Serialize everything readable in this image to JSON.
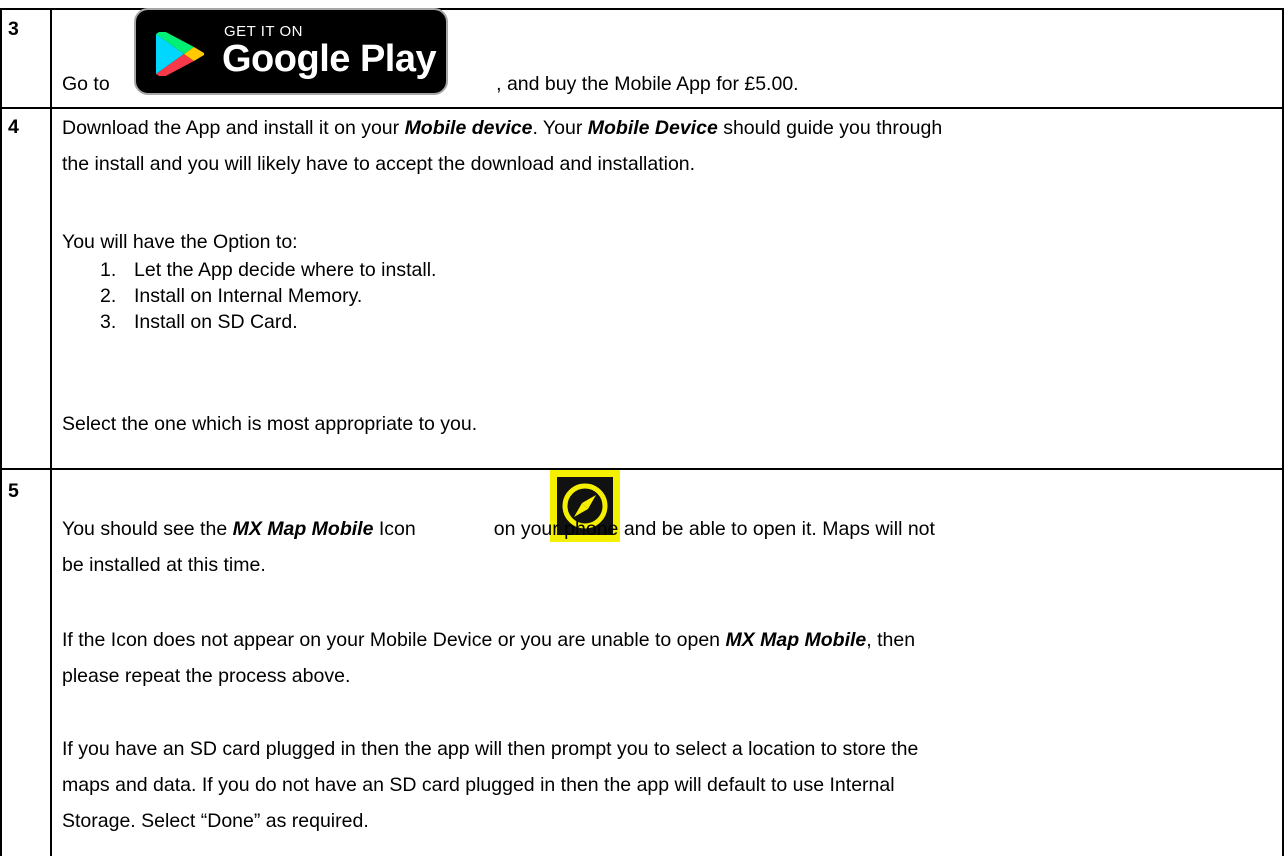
{
  "rows": [
    {
      "number": "3",
      "line1_prefix": "Go to",
      "line1_suffix": ", and buy the Mobile App for £5.00.",
      "badge": {
        "top_text": "GET IT ON",
        "name": "Google Play",
        "icon": "google-play-icon"
      }
    },
    {
      "number": "4",
      "p1_a": "Download the App and install it on your ",
      "p1_b": "Mobile device",
      "p1_c": ".  Your ",
      "p1_d": "Mobile Device",
      "p1_e": " should guide you through",
      "p1_line2": "the install and you will likely have to accept the download and installation.",
      "p2": "You will have the Option to:",
      "options": [
        {
          "n": "1.",
          "text": "Let the App decide where to install."
        },
        {
          "n": "2.",
          "text": "Install on Internal Memory."
        },
        {
          "n": "3.",
          "text": "Install on SD Card."
        }
      ],
      "p3": "Select the one which is most appropriate to you."
    },
    {
      "number": "5",
      "p1_a": "You should see the ",
      "p1_b": "MX Map Mobile",
      "p1_c": " Icon",
      "p1_d": "on your phone and be able to open it.  Maps will not",
      "p1_line2": "be installed at this time.",
      "p2_a": "If the Icon does not appear on your Mobile Device or you are unable to open ",
      "p2_b": "MX Map Mobile",
      "p2_c": ", then",
      "p2_line2": "please repeat the process above.",
      "p3_line1": "If you have an SD card plugged in then the app will then prompt you to select a location to store the",
      "p3_line2": "maps and data.  If you do not have an SD card plugged in then the app will default to use Internal",
      "p3_line3": "Storage. Select “Done” as required.",
      "icon": "mx-map-compass-icon",
      "icon_color": "#f5f000"
    }
  ]
}
